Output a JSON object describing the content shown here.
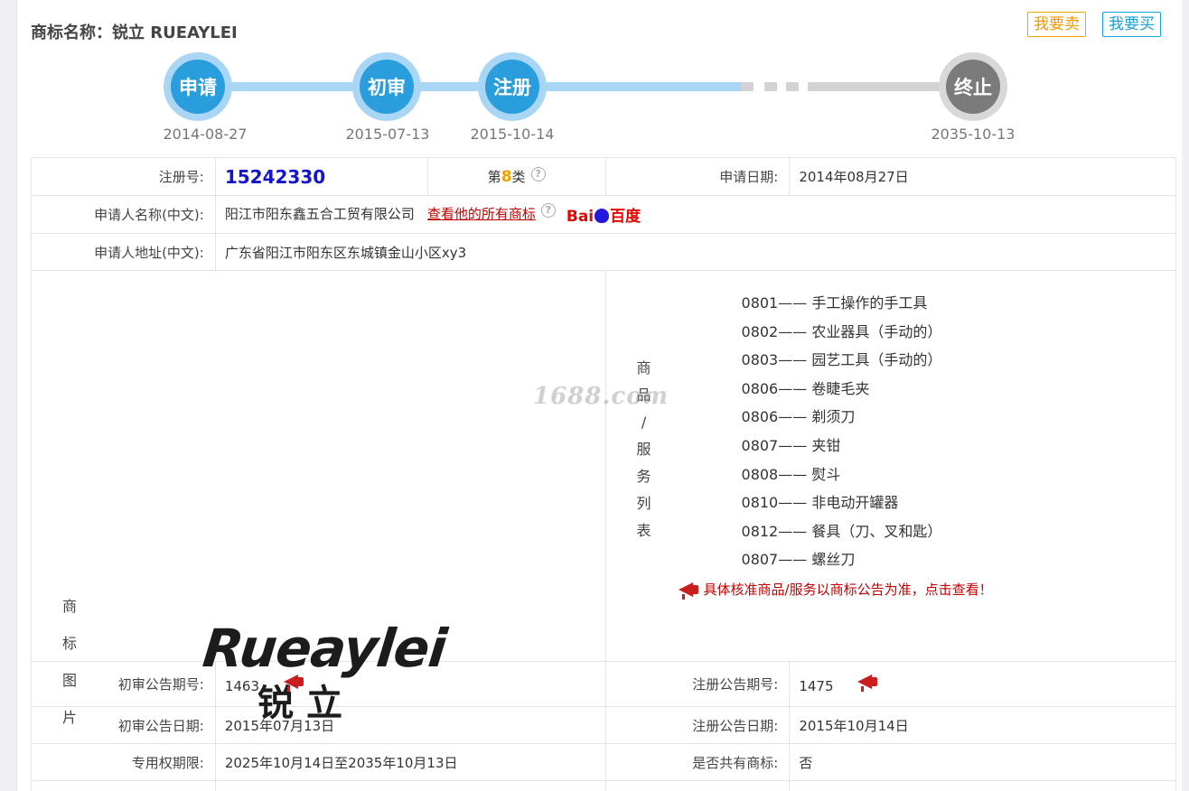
{
  "header": {
    "title": "商标名称：锐立 RUEAYLEI",
    "sell_label": "我要卖",
    "buy_label": "我要买"
  },
  "timeline": {
    "steps": [
      {
        "label": "申请",
        "date": "2014-08-27",
        "status": "done"
      },
      {
        "label": "初审",
        "date": "2015-07-13",
        "status": "done"
      },
      {
        "label": "注册",
        "date": "2015-10-14",
        "status": "done"
      },
      {
        "label": "终止",
        "date": "2035-10-13",
        "status": "pending"
      }
    ]
  },
  "info": {
    "reg_no_label": "注册号:",
    "reg_no": "15242330",
    "class_prefix": "第",
    "class_num": "8",
    "class_suffix": "类",
    "apply_date_label": "申请日期:",
    "apply_date": "2014年08月27日",
    "applicant_name_label": "申请人名称(中文):",
    "applicant_name": "阳江市阳东鑫五合工贸有限公司",
    "all_marks_link": "查看他的所有商标",
    "baidu_left": "Bai",
    "baidu_right": "百度",
    "applicant_addr_label": "申请人地址(中文):",
    "applicant_addr": "广东省阳江市阳东区东城镇金山小区xy3",
    "image_label": [
      "商",
      "标",
      "图",
      "片"
    ],
    "logo_en": "Rueaylei",
    "logo_cn": "锐立",
    "goods_label": [
      "商",
      "品",
      "/",
      "服",
      "务",
      "列",
      "表"
    ],
    "goods": [
      "0801—— 手工操作的手工具",
      "0802—— 农业器具（手动的）",
      "0803—— 园艺工具（手动的）",
      "0806—— 卷睫毛夹",
      "0806—— 剃须刀",
      "0807—— 夹钳",
      "0808—— 熨斗",
      "0810—— 非电动开罐器",
      "0812—— 餐具（刀、叉和匙）",
      "0807—— 螺丝刀"
    ],
    "goods_notice": "具体核准商品/服务以商标公告为准，点击查看！",
    "prelim_no_label": "初审公告期号:",
    "prelim_no": "1463",
    "reg_pub_no_label": "注册公告期号:",
    "reg_pub_no": "1475",
    "prelim_date_label": "初审公告日期:",
    "prelim_date": "2015年07月13日",
    "reg_pub_date_label": "注册公告日期:",
    "reg_pub_date": "2015年10月14日",
    "exclusive_label": "专用权期限:",
    "exclusive": "2025年10月14日至2035年10月13日",
    "shared_label": "是否共有商标:",
    "shared": "否"
  },
  "watermark": "1688.com",
  "colors": {
    "timeline_blue": "#2a9ddd",
    "timeline_grey": "#7b7b7b",
    "reg_no": "#1414c8",
    "class_num": "#f0a000",
    "link_red": "#c00000",
    "sell_orange": "#f39800",
    "buy_blue": "#1a9fd6"
  },
  "icons": [
    "help-icon",
    "megaphone-icon",
    "baidu-logo"
  ]
}
